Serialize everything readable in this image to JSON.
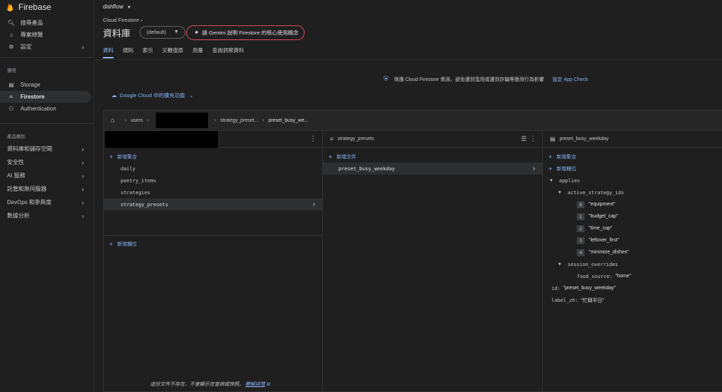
{
  "sidebar": {
    "brand": "Firebase",
    "top_items": [
      {
        "icon": "search-icon",
        "label": "搜尋產品"
      },
      {
        "icon": "home-icon",
        "label": "專案總覽"
      },
      {
        "icon": "gear-icon",
        "label": "設定"
      }
    ],
    "shortcuts_label": "捷徑",
    "shortcuts": [
      {
        "icon": "storage-icon",
        "label": "Storage"
      },
      {
        "icon": "firestore-icon",
        "label": "Firestore"
      },
      {
        "icon": "authentication-icon",
        "label": "Authentication"
      }
    ],
    "categories_label": "產品類別",
    "categories": [
      {
        "label": "資料庫和儲存空間"
      },
      {
        "label": "安全性"
      },
      {
        "label": "AI 服務"
      },
      {
        "label": "託管和無伺服器"
      },
      {
        "label": "DevOps 和參與度"
      },
      {
        "label": "數據分析"
      }
    ]
  },
  "header": {
    "project": "dishflow",
    "breadcrumb": "Cloud Firestore",
    "title": "資料庫",
    "database_select": "(default)",
    "gemini_button": "請 Gemini 說明 Firestore 的核心使用概念"
  },
  "tabs": [
    {
      "label": "資料"
    },
    {
      "label": "規則"
    },
    {
      "label": "索引"
    },
    {
      "label": "災難復原"
    },
    {
      "label": "用量"
    },
    {
      "label": "查詢洞察資料"
    }
  ],
  "appcheck": {
    "text": "保護 Cloud Firestore 資源，避免遭到濫用或遭到詐騙等應用行為影響",
    "link": "設定 App Check"
  },
  "gcloud_link": "Google Cloud 中的擴充功能",
  "path": {
    "segments": [
      "users",
      "strategy_preset...",
      "preset_busy_we..."
    ]
  },
  "col1": {
    "add_collection": "新增集合",
    "items": [
      "daily",
      "pantry_items",
      "strategies",
      "strategy_presets"
    ],
    "add_field": "新增欄位",
    "footer_text": "這份文件不存在，不會顯示在查詢或快照。",
    "footer_link": "瞭解詳情"
  },
  "col2": {
    "title": "strategy_presets",
    "add_document": "新增文件",
    "items": [
      "preset_busy_weekday"
    ]
  },
  "col3": {
    "title": "preset_busy_weekday",
    "add_collection": "新增集合",
    "add_field": "新增欄位",
    "fields": {
      "applies": "applies",
      "active_strategy_ids": "active_strategy_ids",
      "strategy_values": [
        "\"equipment\"",
        "\"budget_cap\"",
        "\"time_cap\"",
        "\"leftover_first\"",
        "\"minimize_dishes\""
      ],
      "strategy_indices": [
        "0",
        "1",
        "2",
        "3",
        "4"
      ],
      "session_overrides": "session_overrides",
      "food_source_key": "food_source:",
      "food_source_val": "\"home\"",
      "id_key": "id:",
      "id_val": "\"preset_busy_weekday\"",
      "label_key": "label_zh:",
      "label_val": "\"忙碌平日\""
    }
  },
  "colors": {
    "accent": "#8ab4f8",
    "gemini_border": "#e04c5a",
    "brand_orange": "#f57c00"
  }
}
